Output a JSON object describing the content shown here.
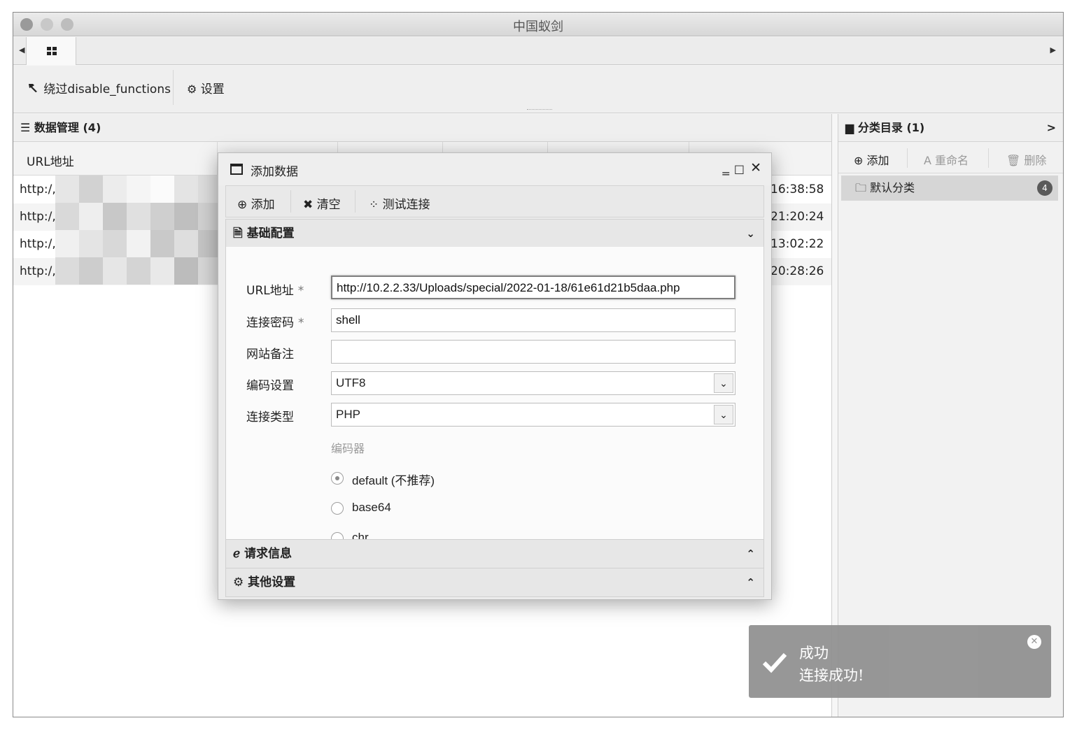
{
  "window": {
    "title": "中国蚁剑"
  },
  "toolbar": {
    "bypass_label": "绕过disable_functions",
    "settings_label": "设置"
  },
  "data_panel": {
    "header": "数据管理 (4)",
    "column_url": "URL地址",
    "rows": [
      {
        "url": "http:/,",
        "time": "16:38:58"
      },
      {
        "url": "http:/,",
        "time": "21:20:24"
      },
      {
        "url": "http:/,",
        "time": "13:02:22"
      },
      {
        "url": "http:/,",
        "time": "20:28:26"
      }
    ]
  },
  "category_panel": {
    "header": "分类目录 (1)",
    "add_label": "添加",
    "rename_label": "重命名",
    "delete_label": "删除",
    "items": [
      {
        "name": "默认分类",
        "count": "4"
      }
    ]
  },
  "modal": {
    "title": "添加数据",
    "toolbar": {
      "add_label": "添加",
      "clear_label": "清空",
      "test_label": "测试连接"
    },
    "sections": {
      "basic": "基础配置",
      "request": "请求信息",
      "other": "其他设置"
    },
    "form": {
      "url_label": "URL地址",
      "url_value": "http://10.2.2.33/Uploads/special/2022-01-18/61e61d21b5daa.php",
      "password_label": "连接密码",
      "password_value": "shell",
      "note_label": "网站备注",
      "note_value": "",
      "encoding_label": "编码设置",
      "encoding_value": "UTF8",
      "type_label": "连接类型",
      "type_value": "PHP",
      "encoder_label": "编码器",
      "encoders": [
        "default (不推荐)",
        "base64",
        "chr"
      ],
      "encoder_selected": "default (不推荐)",
      "required_mark": "*"
    }
  },
  "toast": {
    "title": "成功",
    "message": "连接成功!"
  },
  "icons": {
    "grid": "grid-icon",
    "hammer": "hammer-icon",
    "gear": "gear-icon",
    "list": "list-icon",
    "folder": "folder-icon",
    "plus_circle": "plus-circle-icon",
    "font": "font-icon",
    "trash": "trash-icon",
    "window": "window-icon",
    "close": "close-icon",
    "spinner": "spinner-icon",
    "file": "file-icon",
    "ie": "ie-icon",
    "cogs": "cogs-icon",
    "check": "check-icon"
  }
}
